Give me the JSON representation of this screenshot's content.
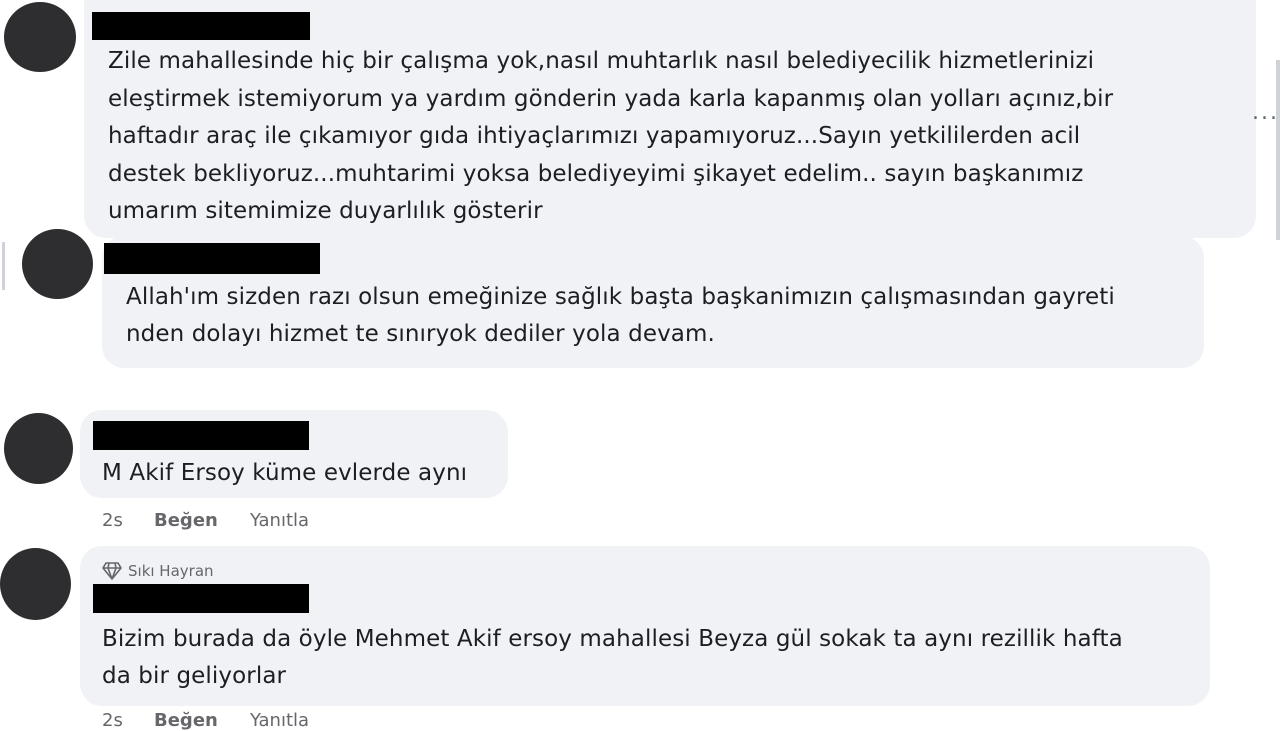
{
  "comments": [
    {
      "lines": [
        "Zile mahallesinde hiç bir çalışma yok,nasıl muhtarlık nasıl belediyecilik hizmetlerinizi",
        "eleştirmek istemiyorum ya yardım gönderin yada karla kapanmış olan yolları açınız,bir",
        "haftadır araç ile çıkamıyor gıda ihtiyaçlarımızı yapamıyoruz...Sayın yetkililerden acil",
        "destek bekliyoruz...muhtarimi yoksa belediyeyimi şikayet edelim.. sayın başkanımız",
        "umarım sitemimize duyarlılık gösterir"
      ]
    },
    {
      "lines": [
        "Allah'ım sizden razı olsun emeğinize sağlık başta başkanimızın çalışmasından gayreti",
        "nden dolayı hizmet te sınıryok dediler yola devam."
      ]
    },
    {
      "lines": [
        "M Akif Ersoy küme evlerde aynı"
      ],
      "time": "2s",
      "like": "Beğen",
      "reply": "Yanıtla"
    },
    {
      "badge": "Sıkı Hayran",
      "badge_icon": "diamond-icon",
      "lines": [
        "Bizim burada da öyle Mehmet Akif ersoy mahallesi Beyza gül sokak ta aynı rezillik hafta",
        "da bir geliyorlar"
      ],
      "time": "2s",
      "like": "Beğen",
      "reply": "Yanıtla"
    }
  ],
  "more_label": "...",
  "colors": {
    "bubble": "#f0f2f5",
    "text": "#1c1e21",
    "muted": "#65676b",
    "avatar": "#2e2e30",
    "redaction": "#000000"
  }
}
